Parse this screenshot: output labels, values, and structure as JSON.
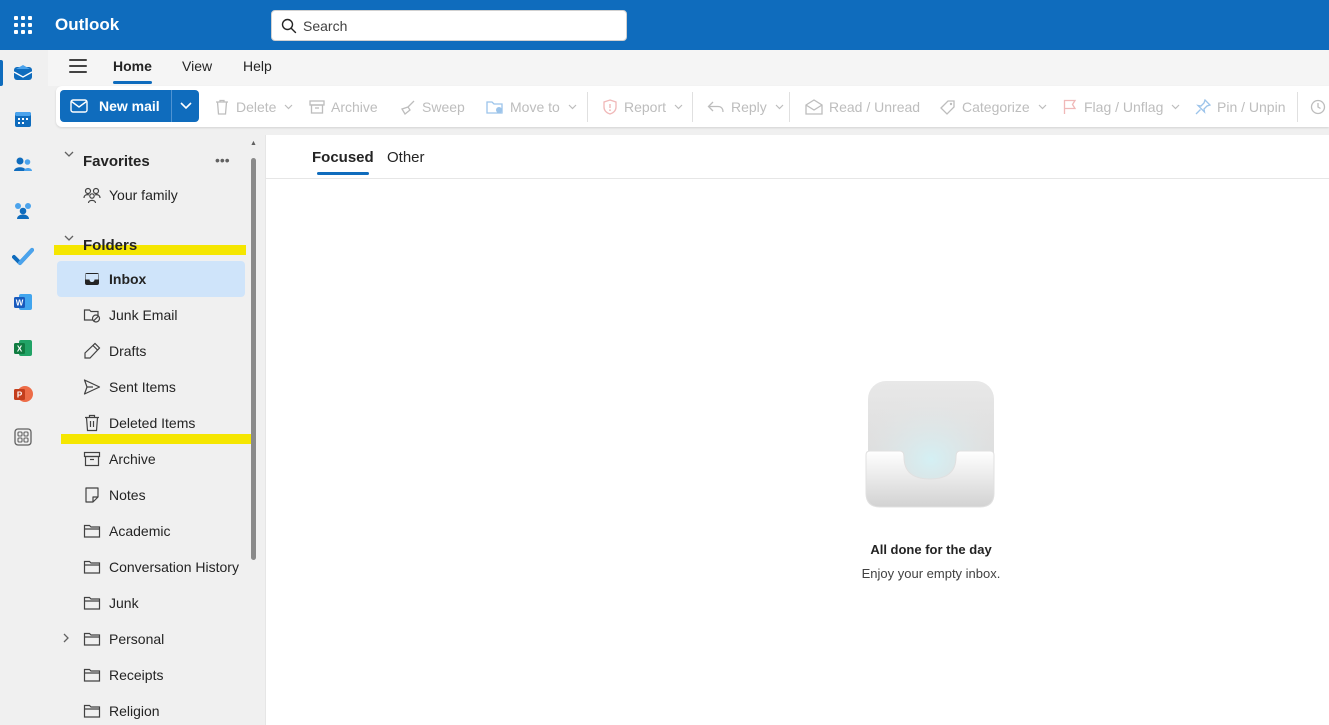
{
  "app": {
    "title": "Outlook"
  },
  "search": {
    "placeholder": "Search"
  },
  "rail": {
    "items": [
      {
        "name": "mail",
        "icon": "mail-icon",
        "active": true
      },
      {
        "name": "calendar",
        "icon": "calendar-icon"
      },
      {
        "name": "people",
        "icon": "people-icon"
      },
      {
        "name": "groups",
        "icon": "groups-icon"
      },
      {
        "name": "to-do",
        "icon": "todo-check-icon"
      },
      {
        "name": "word",
        "icon": "word-icon",
        "letter": "W"
      },
      {
        "name": "excel",
        "icon": "excel-icon",
        "letter": "X"
      },
      {
        "name": "powerpoint",
        "icon": "powerpoint-icon",
        "letter": "P"
      },
      {
        "name": "more-apps",
        "icon": "apps-icon"
      }
    ]
  },
  "ribbon": {
    "tabs": [
      "Home",
      "View",
      "Help"
    ],
    "active_tab": "Home"
  },
  "commands": {
    "new_mail": "New mail",
    "delete": "Delete",
    "archive": "Archive",
    "sweep": "Sweep",
    "move_to": "Move to",
    "report": "Report",
    "reply": "Reply",
    "read_unread": "Read / Unread",
    "categorize": "Categorize",
    "flag_unflag": "Flag / Unflag",
    "pin_unpin": "Pin / Unpin"
  },
  "folder_pane": {
    "favorites_label": "Favorites",
    "favorites": [
      {
        "label": "Your family",
        "icon": "family-icon"
      }
    ],
    "folders_label": "Folders",
    "folders": [
      {
        "label": "Inbox",
        "icon": "inbox-icon",
        "active": true
      },
      {
        "label": "Junk Email",
        "icon": "junk-icon"
      },
      {
        "label": "Drafts",
        "icon": "drafts-icon"
      },
      {
        "label": "Sent Items",
        "icon": "sent-icon"
      },
      {
        "label": "Deleted Items",
        "icon": "trash-icon"
      },
      {
        "label": "Archive",
        "icon": "archive-icon"
      },
      {
        "label": "Notes",
        "icon": "notes-icon"
      },
      {
        "label": "Academic",
        "icon": "folder-icon"
      },
      {
        "label": "Conversation History",
        "icon": "folder-icon"
      },
      {
        "label": "Junk",
        "icon": "folder-icon"
      },
      {
        "label": "Personal",
        "icon": "folder-icon",
        "expandable": true
      },
      {
        "label": "Receipts",
        "icon": "folder-icon"
      },
      {
        "label": "Religion",
        "icon": "folder-icon"
      }
    ]
  },
  "message_list": {
    "tabs": [
      "Focused",
      "Other"
    ],
    "active_tab": "Focused",
    "empty_title": "All done for the day",
    "empty_subtitle": "Enjoy your empty inbox."
  },
  "colors": {
    "brand": "#0f6cbd",
    "selected_folder": "#cfe4fa",
    "highlight": "#f5e600",
    "disabled_text": "#bdbdbd"
  }
}
